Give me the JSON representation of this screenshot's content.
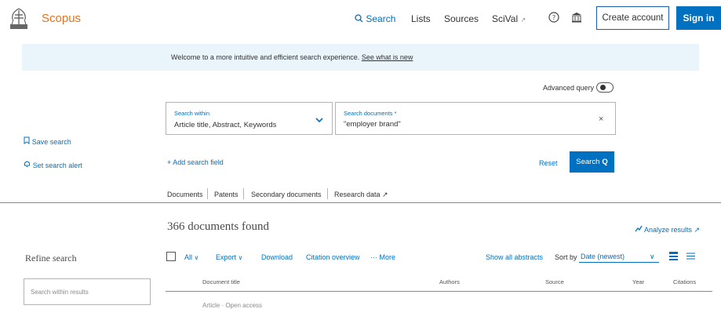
{
  "header": {
    "brand": "Scopus",
    "nav": {
      "search": "Search",
      "lists": "Lists",
      "sources": "Sources",
      "scival": "SciVal",
      "scival_ext": "↗"
    },
    "create_account": "Create account",
    "sign_in": "Sign in"
  },
  "banner": {
    "text": "Welcome to a more intuitive and efficient search experience.",
    "link": "See what is new"
  },
  "search": {
    "advanced_query": "Advanced query",
    "within_label": "Search within",
    "within_value": "Article title, Abstract, Keywords",
    "docs_label": "Search documents *",
    "docs_value": "\"employer brand\"",
    "clear": "×",
    "add_field": "+ Add search field",
    "reset": "Reset",
    "search_button": "Search",
    "search_glyph": "Q"
  },
  "sidebar": {
    "save_search": "Save search",
    "set_alert": "Set search alert"
  },
  "tabs": [
    {
      "label": "Documents"
    },
    {
      "label": "Patents"
    },
    {
      "label": "Secondary documents"
    },
    {
      "label": "Research data ↗"
    }
  ],
  "results": {
    "count_text": "366 documents found",
    "analyze": "Analyze results ↗",
    "refine_title": "Refine search",
    "refine_placeholder": "Search within results"
  },
  "toolbar": {
    "all": "All",
    "export": "Export",
    "download": "Download",
    "citation_overview": "Citation overview",
    "more": "··· More",
    "show_all_abstracts": "Show all abstracts",
    "sort_by": "Sort by",
    "sort_value": "Date (newest)",
    "chevron": "∨"
  },
  "table": {
    "columns": [
      "Document title",
      "Authors",
      "Source",
      "Year",
      "Citations"
    ],
    "first_row_partial": "Article · Open access"
  },
  "colors": {
    "accent": "#0070c0",
    "brand": "#e9711c",
    "banner_bg": "#eaf5fb"
  },
  "icons": [
    "elsevier-logo-icon",
    "search-icon",
    "help-icon",
    "institution-icon",
    "bookmark-icon",
    "bell-icon",
    "chevron-down-icon",
    "close-icon",
    "analyze-icon",
    "list-view-icon",
    "grid-view-icon"
  ]
}
